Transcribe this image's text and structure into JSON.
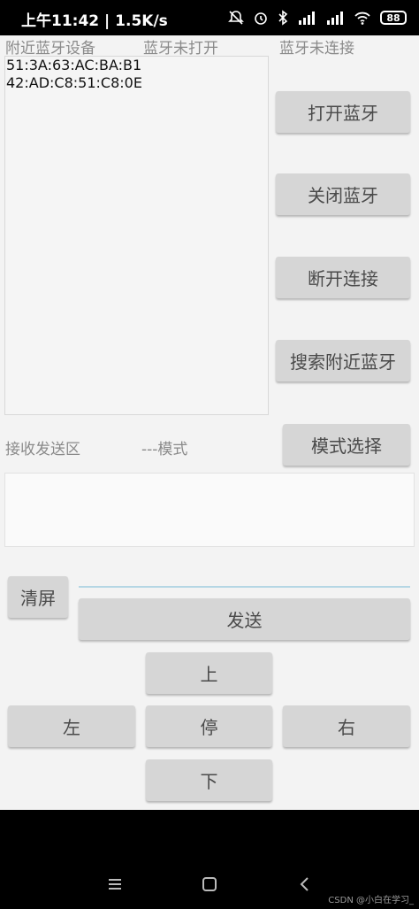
{
  "status_bar": {
    "time": "上午11:42 | 1.5K/s",
    "battery": "88"
  },
  "labels": {
    "nearby_devices": "附近蓝牙设备",
    "bt_state": "蓝牙未打开",
    "connection_state": "蓝牙未连接",
    "receive_send_area": "接收发送区",
    "mode": "---模式"
  },
  "devices": [
    "51:3A:63:AC:BA:B1",
    "42:AD:C8:51:C8:0E"
  ],
  "buttons": {
    "open_bt": "打开蓝牙",
    "close_bt": "关闭蓝牙",
    "disconnect": "断开连接",
    "search_nearby": "搜索附近蓝牙",
    "mode_select": "模式选择",
    "clear_screen": "清屏",
    "send": "发送",
    "up": "上",
    "left": "左",
    "stop": "停",
    "right": "右",
    "down": "下"
  },
  "send_input": {
    "value": ""
  },
  "watermark": "CSDN @小白在学习_"
}
